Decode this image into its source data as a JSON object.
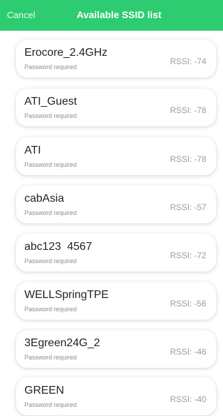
{
  "header": {
    "cancel_label": "Cancel",
    "title": "Available SSID list",
    "color": "#2ecc71"
  },
  "networks": [
    {
      "ssid": "Erocore_2.4GHz",
      "subtitle": "Password required",
      "rssi": "RSSI: -74"
    },
    {
      "ssid": "ATI_Guest",
      "subtitle": "Password required",
      "rssi": "RSSI: -78"
    },
    {
      "ssid": "ATI",
      "subtitle": "Password required",
      "rssi": "RSSI: -78"
    },
    {
      "ssid": "cabAsia",
      "subtitle": "Password required",
      "rssi": "RSSI: -57"
    },
    {
      "ssid": "abc123  4567",
      "subtitle": "Password required",
      "rssi": "RSSI: -72"
    },
    {
      "ssid": "WELLSpringTPE",
      "subtitle": "Password required",
      "rssi": "RSSI: -56"
    },
    {
      "ssid": "3Egreen24G_2",
      "subtitle": "Password required",
      "rssi": "RSSI: -46"
    },
    {
      "ssid": "GREEN",
      "subtitle": "Password required",
      "rssi": "RSSI: -40"
    }
  ]
}
